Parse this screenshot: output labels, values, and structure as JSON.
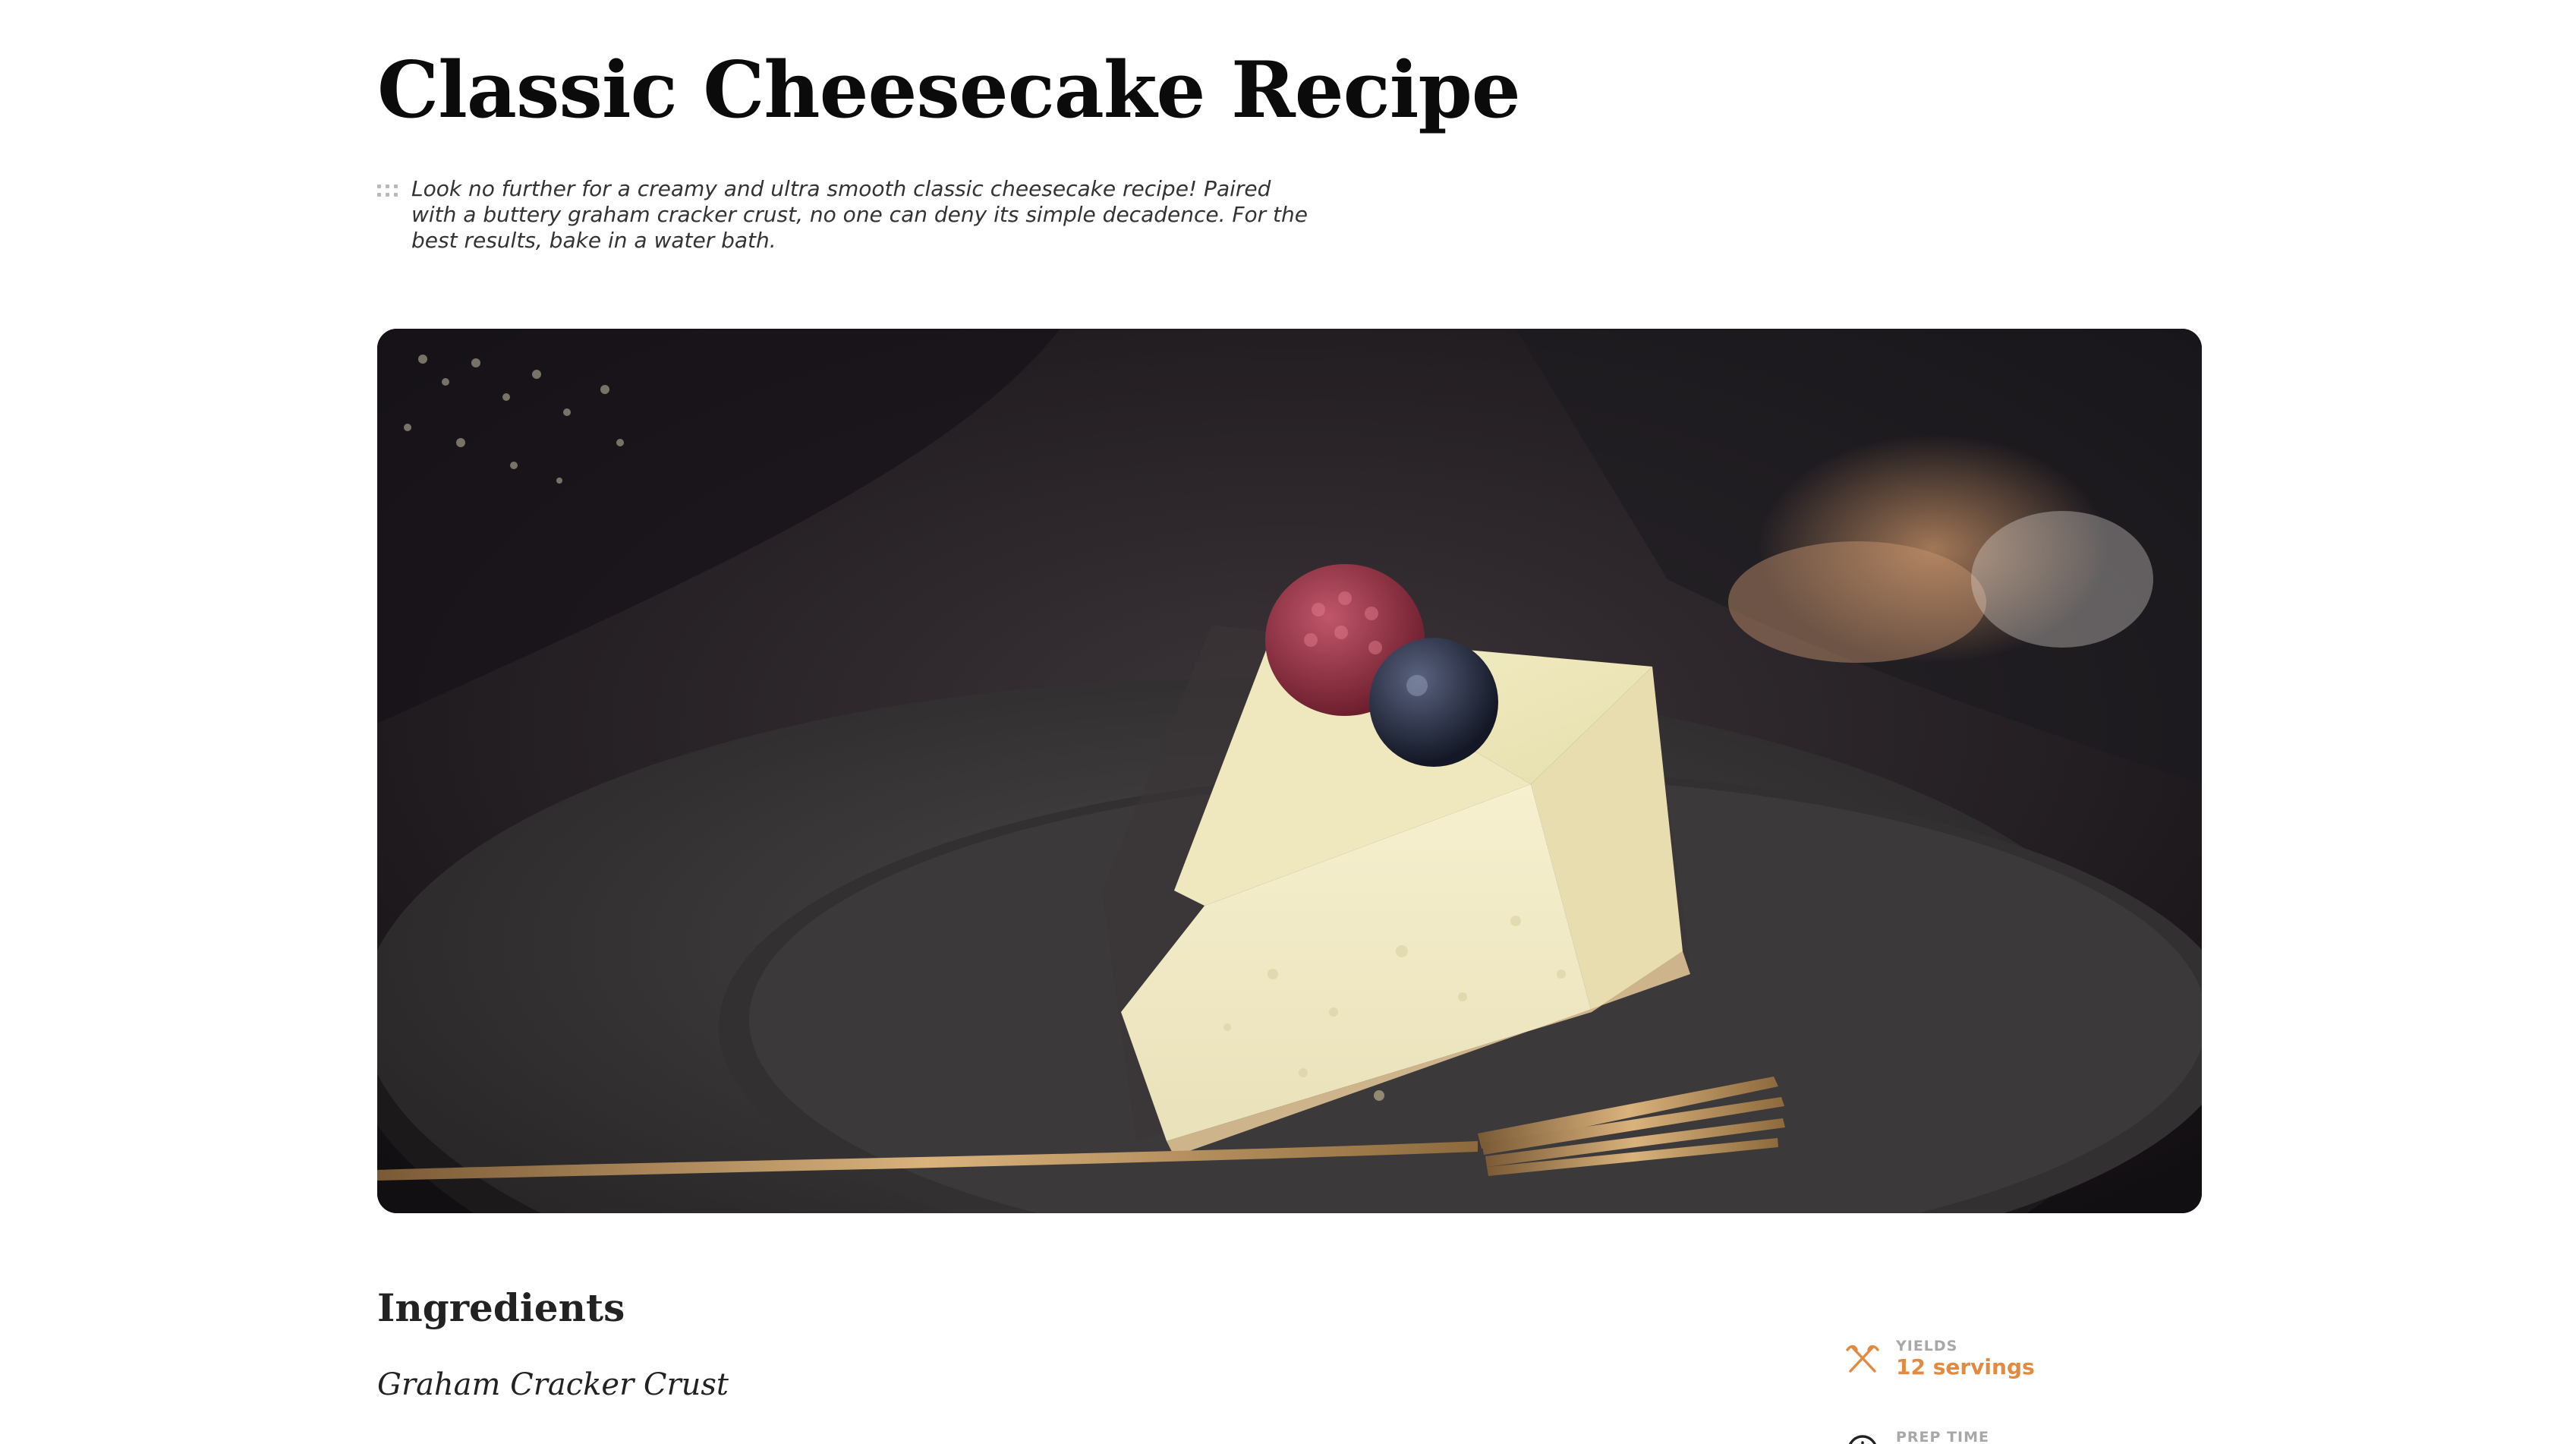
{
  "recipe": {
    "title": "Classic Cheesecake Recipe",
    "description": "Look no further for a creamy and ultra smooth classic cheesecake recipe! Paired with a buttery graham cracker crust, no one can deny its simple decadence. For the best results, bake in a water bath.",
    "hero_image": {
      "alt_subject": "cheesecake-slice-with-berries-on-plate"
    }
  },
  "ingredients": {
    "heading": "Ingredients",
    "sections": [
      {
        "title": "Graham Cracker Crust"
      }
    ]
  },
  "meta": {
    "yields": {
      "label": "YIELDS",
      "value": "12 servings",
      "icon": "utensils-icon"
    },
    "prep_time": {
      "label": "PREP TIME",
      "value": "",
      "icon": "clock-icon"
    }
  },
  "colors": {
    "accent": "#e28a3f",
    "title": "#0b0b0b",
    "muted_label": "#a8a8a8"
  }
}
